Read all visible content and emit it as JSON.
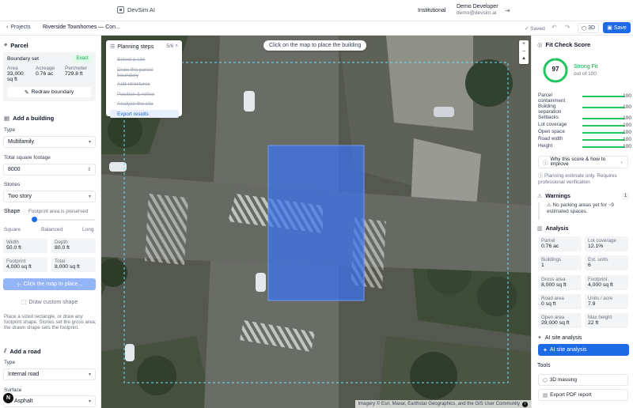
{
  "app": {
    "name": "DevSim AI"
  },
  "header": {
    "plan": "Institutional",
    "user_name": "Demo Developer",
    "user_email": "demo@devsim.ai",
    "logout_icon": "logout-icon"
  },
  "toolbar": {
    "back_label": "Projects",
    "project_name": "Riverside Townhomes — Con...",
    "saved_label": "Saved",
    "btn_3d_label": "3D",
    "save_label": "Save"
  },
  "parcel": {
    "title": "Parcel",
    "boundary_label": "Boundary set",
    "badge": "Exact",
    "area_label": "Area",
    "area_value": "33,000",
    "area_unit": "sq ft",
    "acreage_label": "Acreage",
    "acreage_value": "0.76 ac",
    "perimeter_label": "Perimeter",
    "perimeter_value": "729.8 ft",
    "redraw_label": "Redraw boundary"
  },
  "building": {
    "title": "Add a building",
    "type_label": "Type",
    "type_value": "Multifamily",
    "sqft_label": "Total square footage",
    "sqft_value": "8000",
    "stories_label": "Stories",
    "stories_value": "Two story",
    "shape_label": "Shape",
    "shape_note": "Footprint area is preserved",
    "shape_position": 0.0,
    "shape_options": [
      "Square",
      "Balanced",
      "Long"
    ],
    "width_label": "Width",
    "width_value": "50.0 ft",
    "depth_label": "Depth",
    "depth_value": "80.0 ft",
    "footprint_label": "Footprint",
    "footprint_value": "4,000 sq ft",
    "total_label": "Total",
    "total_value": "8,000 sq ft",
    "place_label": "Click the map to place...",
    "custom_label": "Draw custom shape",
    "help_text": "Place a sized rectangle, or draw any footprint shape. Stories set the gross area; the drawn shape sets the footprint."
  },
  "road": {
    "title": "Add a road",
    "type_label": "Type",
    "type_value": "Internal road",
    "surface_label": "Surface",
    "surface_value": "Asphalt"
  },
  "user_avatar": "N",
  "map": {
    "hint": "Click on the map to place the building",
    "zoom_in": "+",
    "zoom_out": "−",
    "attribution": "Imagery © Esri, Maxar, Earthstar Geographics, and the GIS User Community",
    "info_icon": "info-icon"
  },
  "planning_steps": {
    "title": "Planning steps",
    "count": "5/6",
    "steps": [
      "Select a site",
      "Draw the parcel boundary",
      "Add structures",
      "Position & refine",
      "Analyze the site",
      "Export results"
    ]
  },
  "fit_check": {
    "title": "Fit Check Score",
    "score": "97",
    "score_value": 97,
    "rating": "Strong Fit",
    "out_of": "out of 100",
    "metrics": [
      {
        "name": "Parcel containment",
        "value": 100,
        "label": "100"
      },
      {
        "name": "Building separation",
        "value": 100,
        "label": "100"
      },
      {
        "name": "Setbacks",
        "value": 100,
        "label": "100"
      },
      {
        "name": "Lot coverage",
        "value": 100,
        "label": "100"
      },
      {
        "name": "Open space",
        "value": 100,
        "label": "100"
      },
      {
        "name": "Road width",
        "value": 100,
        "label": "100"
      },
      {
        "name": "Height",
        "value": 100,
        "label": "100"
      }
    ],
    "why_label": "Why this score & how to improve",
    "disclaimer": "Planning estimate only. Requires professional verification"
  },
  "warnings": {
    "title": "Warnings",
    "count": "1",
    "text": "No parking areas yet for ~9 estimated spaces."
  },
  "analysis": {
    "title": "Analysis",
    "stats": [
      {
        "k": "Parcel",
        "v": "0.76 ac"
      },
      {
        "k": "Lot coverage",
        "v": "12.1%"
      },
      {
        "k": "Buildings",
        "v": "1"
      },
      {
        "k": "Est. units",
        "v": "6"
      },
      {
        "k": "Gross area",
        "v": "8,000 sq ft"
      },
      {
        "k": "Footprint",
        "v": "4,000 sq ft"
      },
      {
        "k": "Road area",
        "v": "0 sq ft"
      },
      {
        "k": "Units / acre",
        "v": "7.9"
      },
      {
        "k": "Open area",
        "v": "29,000 sq ft"
      },
      {
        "k": "Max height",
        "v": "22 ft"
      }
    ]
  },
  "ai": {
    "title": "AI site analysis",
    "button_label": "AI site analysis"
  },
  "tools": {
    "title": "Tools",
    "massing_label": "3D massing",
    "export_label": "Export PDF report"
  }
}
